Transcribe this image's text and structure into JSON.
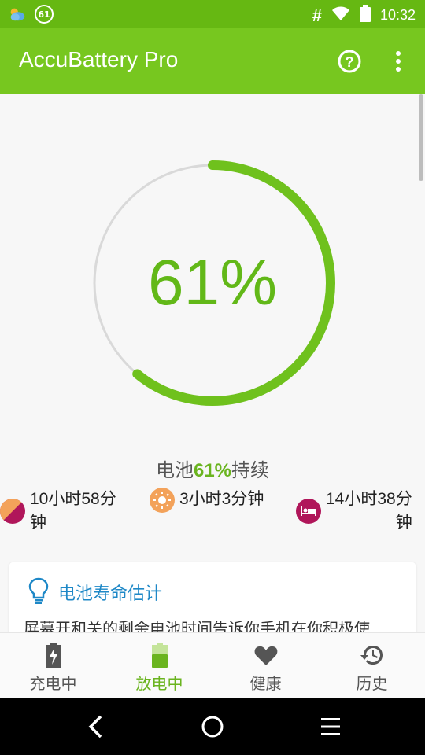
{
  "status_bar": {
    "left_icons": [
      "weather-icon",
      "battery-notification-icon"
    ],
    "notif_text": "61",
    "right_icons": [
      "hash-icon",
      "wifi-icon",
      "battery-icon"
    ],
    "time": "10:32"
  },
  "app_bar": {
    "title": "AccuBattery Pro",
    "actions": [
      "help-icon",
      "more-vert-icon"
    ]
  },
  "battery": {
    "percentage_text": "61%",
    "percentage_value": 61,
    "ring_color": "#6fc11d"
  },
  "duration": {
    "prefix": "电池",
    "percent": "61%",
    "suffix": "持续"
  },
  "stats": [
    {
      "icon": "mixed-usage-icon",
      "text_line1": "10小时58分",
      "text_line2": "钟"
    },
    {
      "icon": "screen-on-icon",
      "text_line1": "3小时3分钟",
      "text_line2": ""
    },
    {
      "icon": "screen-off-icon",
      "text_line1": "14小时38分",
      "text_line2": "钟"
    }
  ],
  "card": {
    "icon": "lightbulb-icon",
    "title": "电池寿命估计",
    "body": "屏幕开和关的剩余电池时间告诉你手机在你积极使"
  },
  "bottom_nav": [
    {
      "icon": "charging-icon",
      "label": "充电中",
      "active": false
    },
    {
      "icon": "discharging-icon",
      "label": "放电中",
      "active": true
    },
    {
      "icon": "heart-icon",
      "label": "健康",
      "active": false
    },
    {
      "icon": "history-icon",
      "label": "历史",
      "active": false
    }
  ],
  "sys_nav": [
    "back-icon",
    "home-icon",
    "menu-icon"
  ],
  "colors": {
    "primary": "#77c71f",
    "status_bar": "#66b812",
    "accent_text": "#6ab41f",
    "card_title": "#1e88c7",
    "magenta": "#b0165a",
    "orange": "#f3a25a"
  }
}
